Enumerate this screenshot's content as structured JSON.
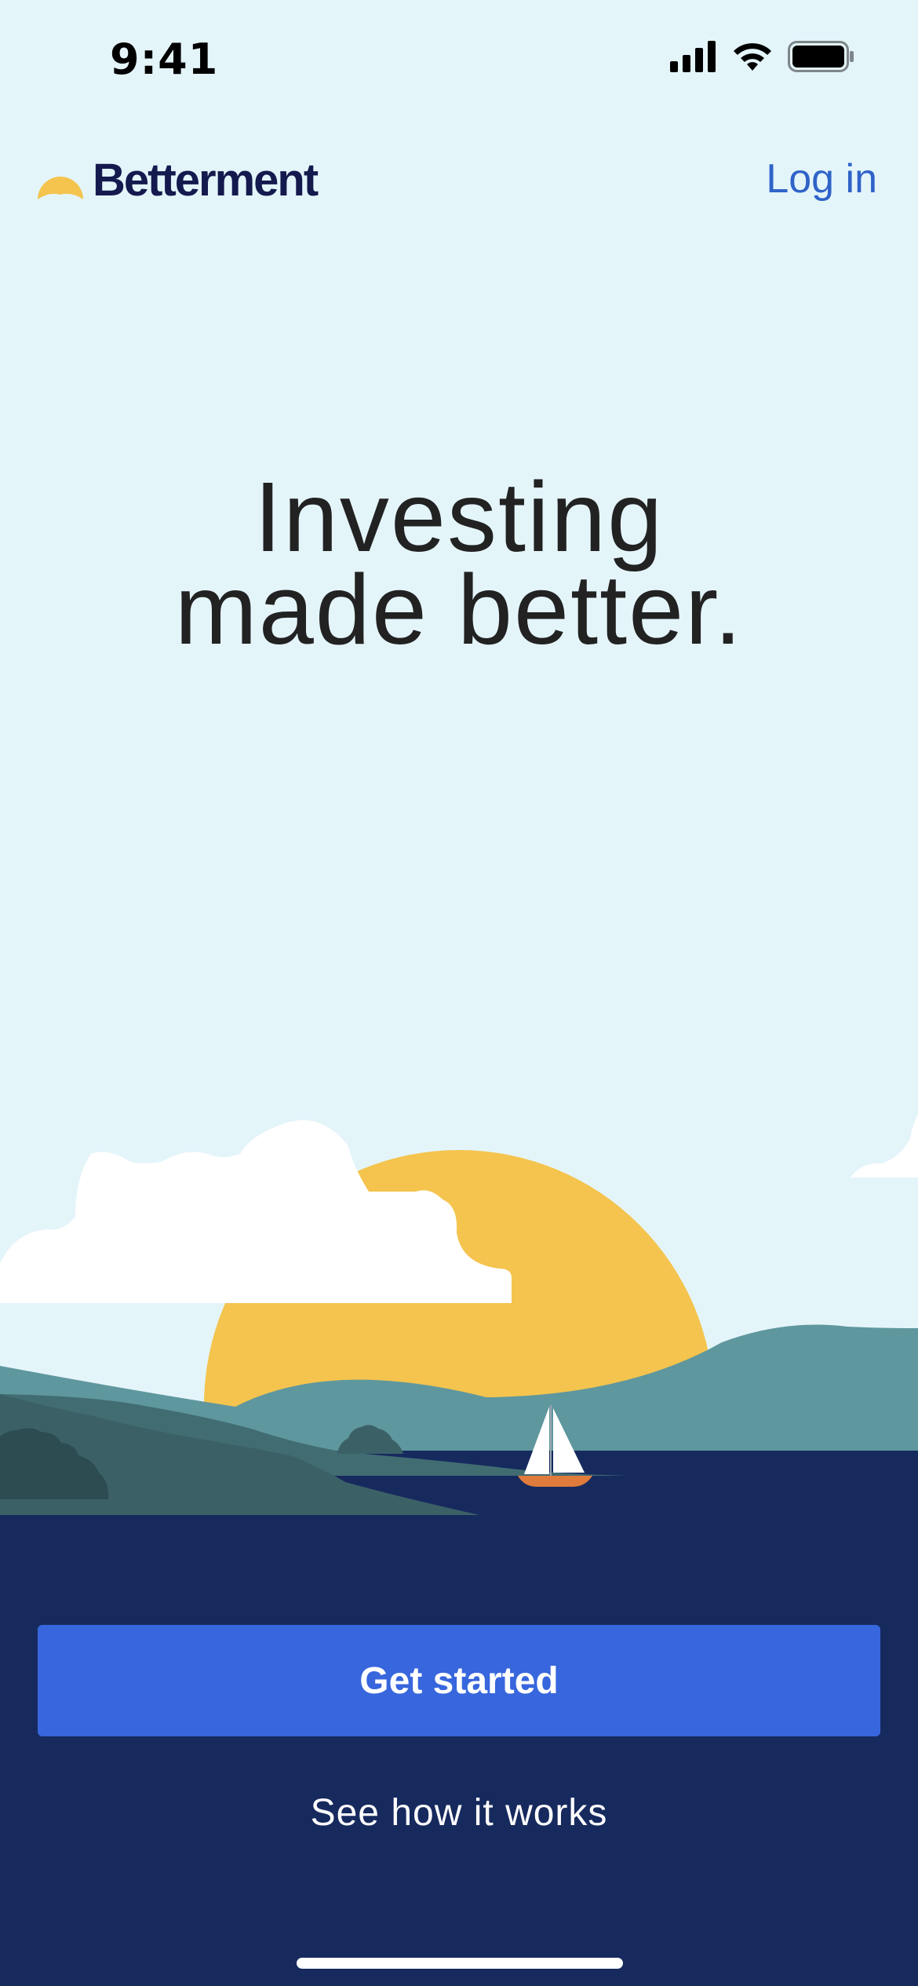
{
  "status_bar": {
    "time": "9:41",
    "icons": [
      "signal-icon",
      "wifi-icon",
      "battery-icon"
    ]
  },
  "header": {
    "brand": "Betterment",
    "login_label": "Log in"
  },
  "hero": {
    "line1": "Investing",
    "line2": "made better."
  },
  "actions": {
    "primary_label": "Get started",
    "secondary_label": "See how it works"
  },
  "colors": {
    "sky": "#e4f5fa",
    "brand_text": "#141a4e",
    "link": "#2f63c8",
    "sun": "#f4c44e",
    "water": "#172a5e",
    "button": "#3766dd"
  }
}
